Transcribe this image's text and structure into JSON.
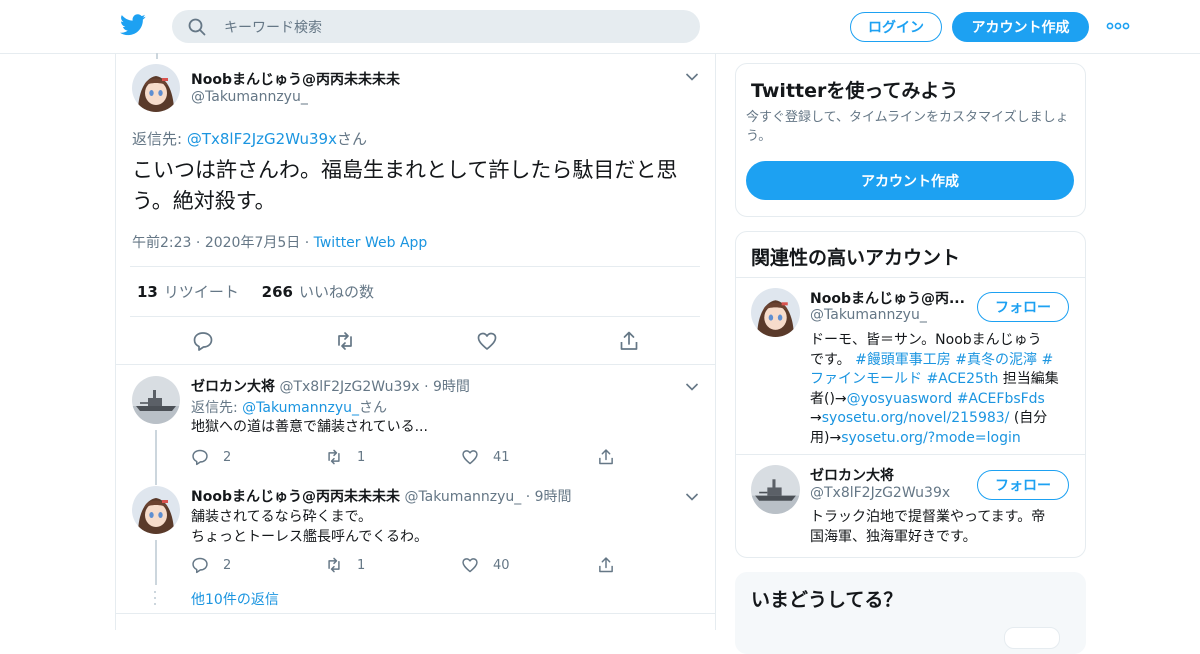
{
  "header": {
    "search_placeholder": "キーワード検索",
    "login": "ログイン",
    "signup": "アカウント作成"
  },
  "main_tweet": {
    "name": "Noobまんじゅう@丙丙未未未未",
    "handle": "@Takumannzyu_",
    "reply_label": "返信先: ",
    "reply_to": "@Tx8lF2JzG2Wu39x",
    "reply_suffix": "さん",
    "text": "こいつは許さんわ。福島生まれとして許したら駄目だと思う。絶対殺す。",
    "time": "午前2:23",
    "date": "2020年7月5日",
    "source": "Twitter Web App",
    "retweets": "13",
    "retweets_label": "リツイート",
    "likes": "266",
    "likes_label": "いいねの数"
  },
  "replies": [
    {
      "name": "ゼロカン大将",
      "handle": "@Tx8lF2JzG2Wu39x",
      "time": "9時間",
      "reply_label": "返信先: ",
      "reply_to": "@Takumannzyu_",
      "reply_suffix": "さん",
      "text": "地獄への道は善意で舗装されている...",
      "replies": "2",
      "retweets": "1",
      "likes": "41"
    },
    {
      "name": "Noobまんじゅう@丙丙未未未未",
      "handle": "@Takumannzyu_",
      "time": "9時間",
      "text_line1": "舗装されてるなら砕くまで。",
      "text_line2": "ちょっとトーレス艦長呼んでくるわ。",
      "replies": "2",
      "retweets": "1",
      "likes": "40"
    }
  ],
  "more_replies": "他10件の返信",
  "signup_card": {
    "title": "Twitterを使ってみよう",
    "desc_line1": "今すぐ登録して、タイムラインをカスタマイズしましょ",
    "desc_line2": "う。",
    "button": "アカウント作成"
  },
  "related": {
    "title": "関連性の高いアカウント",
    "follow": "フォロー",
    "accounts": [
      {
        "name": "Noobまんじゅう@丙...",
        "handle": "@Takumannzyu_",
        "bio_line1": "ドーモ、皆＝サン。Noobまんじゅう",
        "bio_line2_a": "です。 ",
        "bio_tag1": "#饅頭軍事工房",
        "bio_tag2": "#真冬の泥濘",
        "bio_tag2b": "#",
        "bio_tag3": "ファインモールド",
        "bio_tag4": "#ACE25th",
        "bio_line4_b": " 担当編集",
        "bio_line5_a": "者()→",
        "bio_tag5": "@yosyuasword",
        "bio_tag6": "#ACEFbsFds",
        "bio_line6_a": "→",
        "bio_link1": "syosetu.org/novel/215983/",
        "bio_line6_b": " (自分",
        "bio_line7_a": "用)→",
        "bio_link2": "syosetu.org/?mode=login"
      },
      {
        "name": "ゼロカン大将",
        "handle": "@Tx8lF2JzG2Wu39x",
        "bio_line1": "トラック泊地で提督業やってます。帝",
        "bio_line2": "国海軍、独海軍好きです。"
      }
    ]
  },
  "whats_happening": {
    "title": "いまどうしてる？"
  },
  "colors": {
    "accent": "#1da1f2",
    "link": "#1b95e0",
    "secondary_text": "#657786",
    "border": "#e6ecf0"
  },
  "icons": [
    "twitter-logo-icon",
    "search-icon",
    "more-dots-icon",
    "chevron-down-icon",
    "reply-icon",
    "retweet-icon",
    "like-icon",
    "share-icon"
  ]
}
